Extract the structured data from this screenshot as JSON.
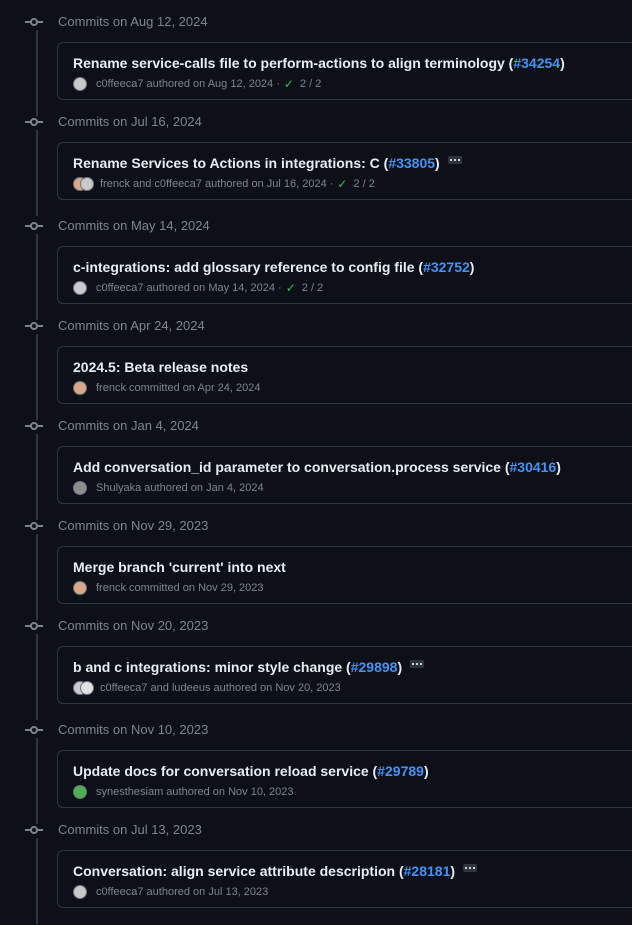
{
  "colors": {
    "background": "#0d1117",
    "border": "#30363d",
    "muted": "#7d8590",
    "link": "#4493f8",
    "success": "#3fb950"
  },
  "groups": [
    {
      "heading": "Commits on Aug 12, 2024",
      "commits": [
        {
          "title": "Rename service-calls file to perform-actions to align terminology (",
          "pr": "#34254",
          "title_end": ")",
          "has_dots": false,
          "avatars": [
            "#c9c9c9"
          ],
          "meta": "c0ffeeca7 authored on Aug 12, 2024 ·",
          "checks": "2 / 2"
        }
      ]
    },
    {
      "heading": "Commits on Jul 16, 2024",
      "commits": [
        {
          "title": "Rename Services to Actions in integrations: C (",
          "pr": "#33805",
          "title_end": ")",
          "has_dots": true,
          "avatars": [
            "#d9a88a",
            "#c9c9c9"
          ],
          "meta": "frenck and c0ffeeca7 authored on Jul 16, 2024 ·",
          "checks": "2 / 2"
        }
      ]
    },
    {
      "heading": "Commits on May 14, 2024",
      "commits": [
        {
          "title": "c-integrations: add glossary reference to config file (",
          "pr": "#32752",
          "title_end": ")",
          "has_dots": false,
          "avatars": [
            "#c9c9c9"
          ],
          "meta": "c0ffeeca7 authored on May 14, 2024 ·",
          "checks": "2 / 2"
        }
      ]
    },
    {
      "heading": "Commits on Apr 24, 2024",
      "commits": [
        {
          "title": "2024.5: Beta release notes",
          "pr": "",
          "title_end": "",
          "has_dots": false,
          "avatars": [
            "#d9a88a"
          ],
          "meta": "frenck committed on Apr 24, 2024",
          "checks": ""
        }
      ]
    },
    {
      "heading": "Commits on Jan 4, 2024",
      "commits": [
        {
          "title": "Add conversation_id parameter to conversation.process service (",
          "pr": "#30416",
          "title_end": ")",
          "has_dots": false,
          "avatars": [
            "#8b8b8b"
          ],
          "meta": "Shulyaka authored on Jan 4, 2024",
          "checks": ""
        }
      ]
    },
    {
      "heading": "Commits on Nov 29, 2023",
      "commits": [
        {
          "title": "Merge branch 'current' into next",
          "pr": "",
          "title_end": "",
          "has_dots": false,
          "avatars": [
            "#d9a88a"
          ],
          "meta": "frenck committed on Nov 29, 2023",
          "checks": ""
        }
      ]
    },
    {
      "heading": "Commits on Nov 20, 2023",
      "commits": [
        {
          "title": "b and c integrations: minor style change (",
          "pr": "#29898",
          "title_end": ")",
          "has_dots": true,
          "avatars": [
            "#c9c9c9",
            "#e0e0e0"
          ],
          "meta": "c0ffeeca7 and ludeeus authored on Nov 20, 2023",
          "checks": ""
        }
      ]
    },
    {
      "heading": "Commits on Nov 10, 2023",
      "commits": [
        {
          "title": "Update docs for conversation reload service (",
          "pr": "#29789",
          "title_end": ")",
          "has_dots": false,
          "avatars": [
            "#4caf50"
          ],
          "meta": "synesthesiam authored on Nov 10, 2023",
          "checks": ""
        }
      ]
    },
    {
      "heading": "Commits on Jul 13, 2023",
      "commits": [
        {
          "title": "Conversation: align service attribute description (",
          "pr": "#28181",
          "title_end": ")",
          "has_dots": true,
          "avatars": [
            "#c9c9c9"
          ],
          "meta": "c0ffeeca7 authored on Jul 13, 2023",
          "checks": ""
        }
      ]
    }
  ]
}
